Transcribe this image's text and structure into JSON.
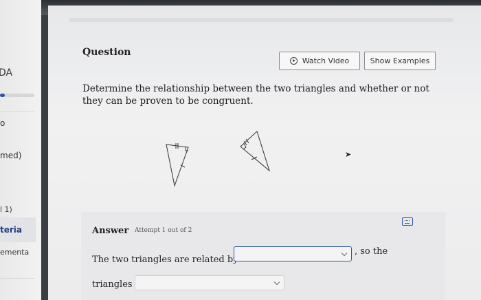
{
  "sidebar": {
    "items": [
      {
        "label": "DA"
      },
      {
        "label": "o"
      },
      {
        "label": "med)"
      },
      {
        "label": "l 1)"
      },
      {
        "label": "teria"
      },
      {
        "label": "ementa"
      }
    ],
    "progress_fraction": 0.14,
    "accent_color": "#2d56a8"
  },
  "question": {
    "title": "Question",
    "watch_video_label": "Watch Video",
    "show_examples_label": "Show Examples",
    "prompt": "Determine the relationship between the two triangles and whether or not they can be proven to be congruent."
  },
  "answer": {
    "label": "Answer",
    "attempt": "Attempt 1 out of 2",
    "sentence_start": "The two triangles are related by",
    "sentence_mid": ", so the",
    "sentence_end": "triangles",
    "dropdown1_value": "",
    "dropdown2_value": "",
    "keyboard_icon": "keyboard-icon"
  }
}
